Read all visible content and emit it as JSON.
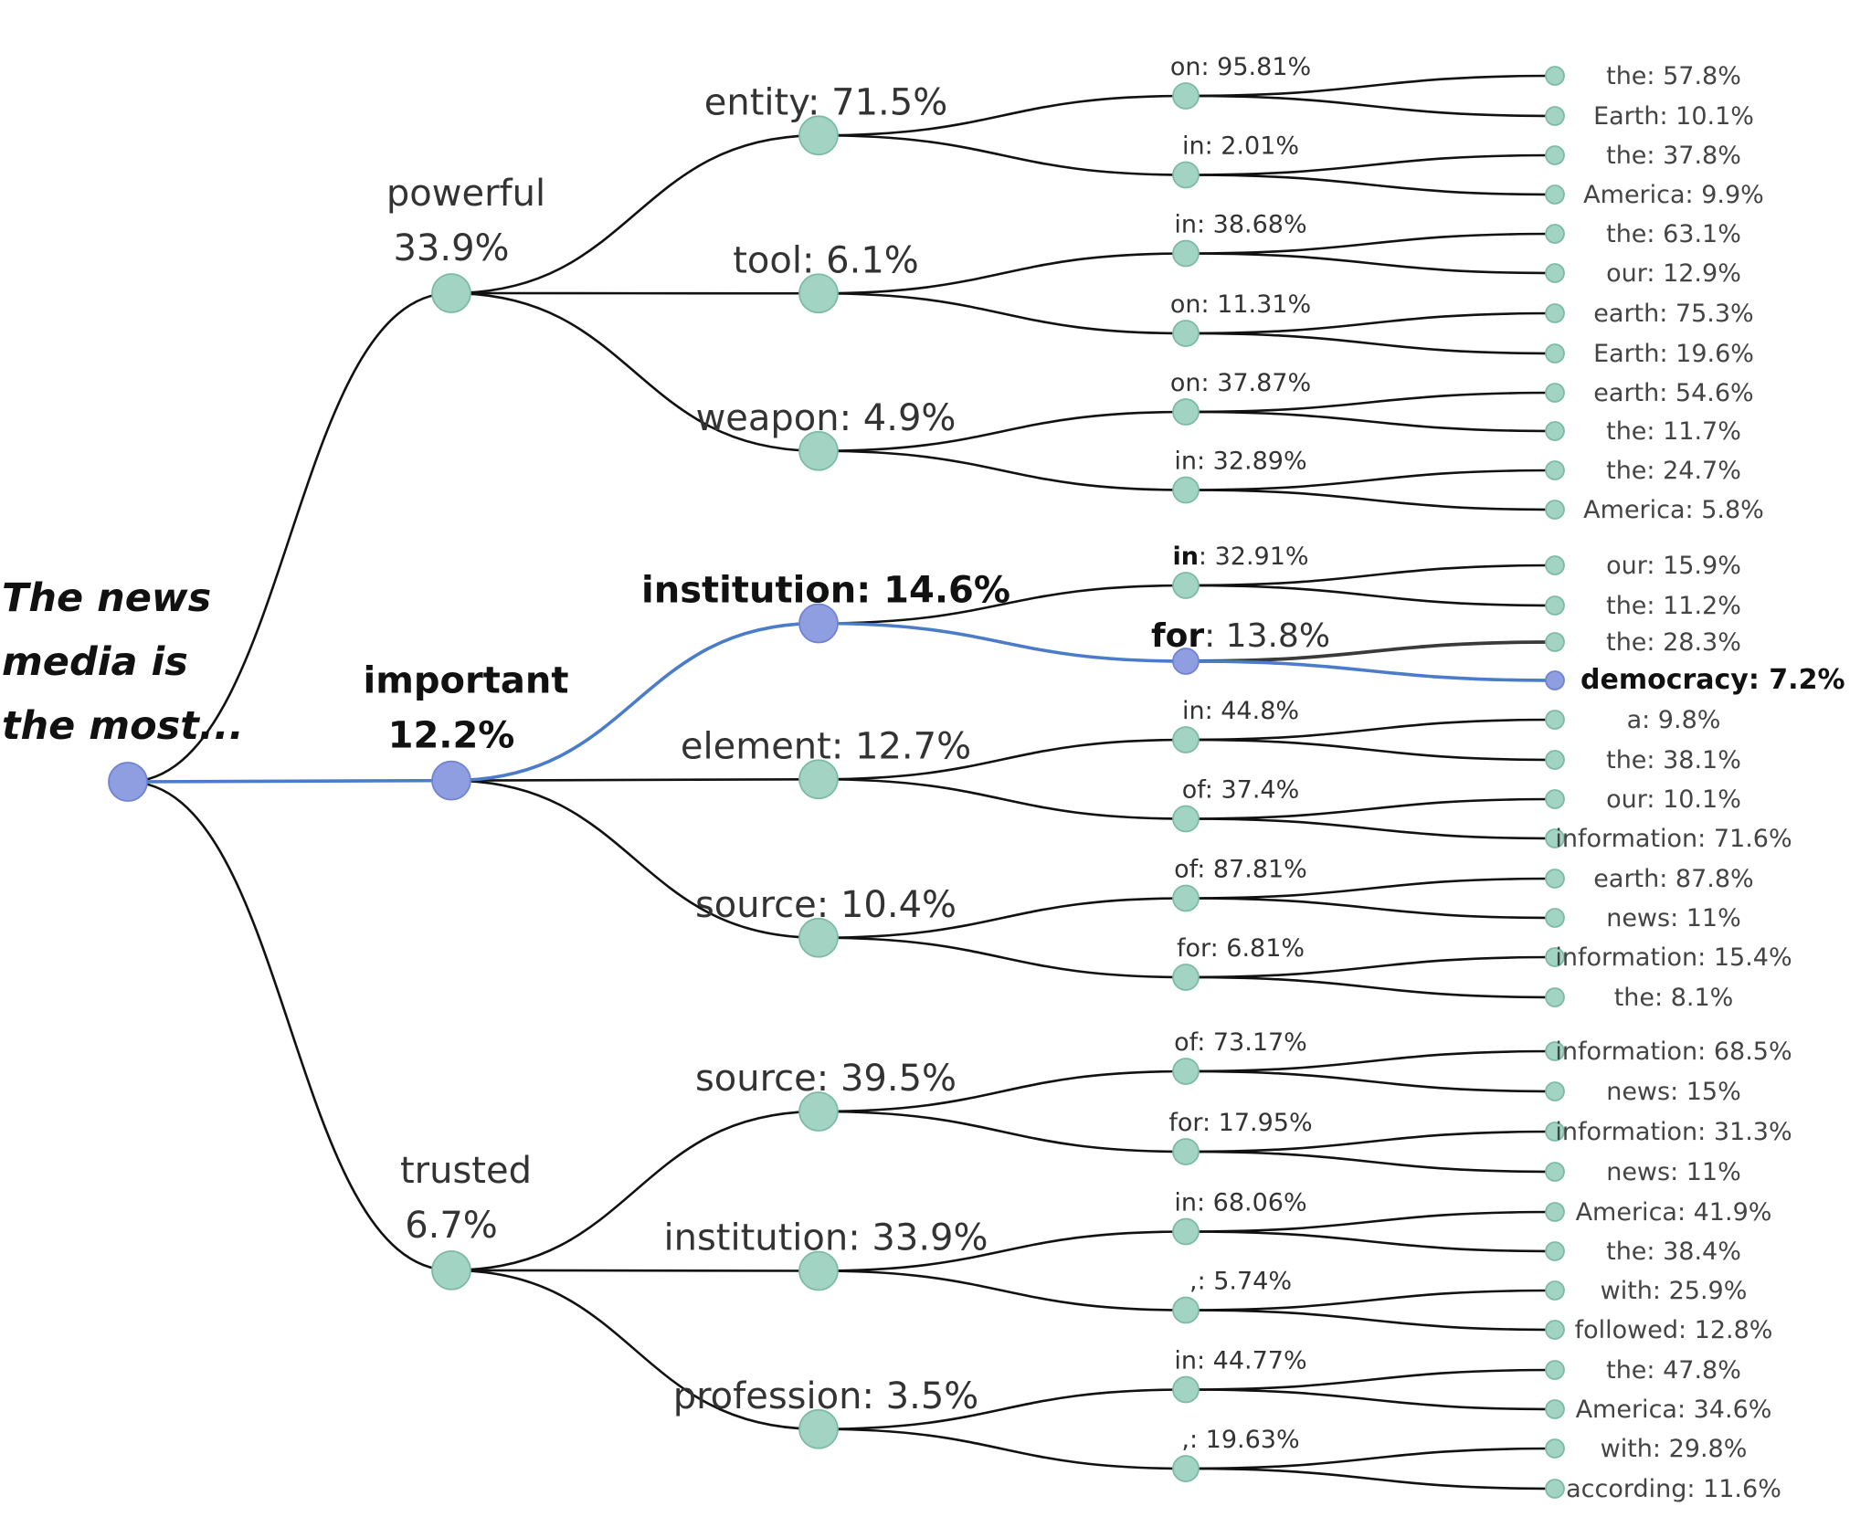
{
  "colors": {
    "node": "#a3d3c2",
    "node_highlight": "#8f9ee0",
    "edge": "#111111",
    "edge_highlight": "#4a7cc9"
  },
  "root": {
    "lines": [
      "The news",
      "media is",
      "the most..."
    ],
    "highlight": true,
    "children": [
      {
        "word": "powerful",
        "prob": "33.9%",
        "children": [
          {
            "label": "entity: 71.5%",
            "children": [
              {
                "word": "on",
                "prob": "95.81%",
                "children": [
                  {
                    "label": "the: 57.8%"
                  },
                  {
                    "label": "Earth: 10.1%"
                  }
                ]
              },
              {
                "word": "in",
                "prob": "2.01%",
                "children": [
                  {
                    "label": "the: 37.8%"
                  },
                  {
                    "label": "America: 9.9%"
                  }
                ]
              }
            ]
          },
          {
            "label": "tool: 6.1%",
            "children": [
              {
                "word": "in",
                "prob": "38.68%",
                "children": [
                  {
                    "label": "the: 63.1%"
                  },
                  {
                    "label": "our: 12.9%"
                  }
                ]
              },
              {
                "word": "on",
                "prob": "11.31%",
                "children": [
                  {
                    "label": "earth: 75.3%"
                  },
                  {
                    "label": "Earth: 19.6%"
                  }
                ]
              }
            ]
          },
          {
            "label": "weapon: 4.9%",
            "children": [
              {
                "word": "on",
                "prob": "37.87%",
                "children": [
                  {
                    "label": "earth: 54.6%"
                  },
                  {
                    "label": "the: 11.7%"
                  }
                ]
              },
              {
                "word": "in",
                "prob": "32.89%",
                "children": [
                  {
                    "label": "the: 24.7%"
                  },
                  {
                    "label": "America: 5.8%"
                  }
                ]
              }
            ]
          }
        ]
      },
      {
        "word": "important",
        "prob": "12.2%",
        "highlight": true,
        "children": [
          {
            "label": "institution: 14.6%",
            "highlight": true,
            "children": [
              {
                "word": "in",
                "prob": "32.91%",
                "bold_word": true,
                "children": [
                  {
                    "label": "our: 15.9%"
                  },
                  {
                    "label": "the: 11.2%"
                  }
                ]
              },
              {
                "word": "for",
                "prob": "13.8%",
                "highlight": true,
                "bold_word": true,
                "children": [
                  {
                    "label": "the: 28.3%",
                    "dark_edge": true
                  },
                  {
                    "label": "democracy: 7.2%",
                    "highlight": true
                  }
                ]
              }
            ]
          },
          {
            "label": "element: 12.7%",
            "children": [
              {
                "word": "in",
                "prob": "44.8%",
                "children": [
                  {
                    "label": "a: 9.8%"
                  },
                  {
                    "label": "the: 38.1%"
                  }
                ]
              },
              {
                "word": "of",
                "prob": "37.4%",
                "children": [
                  {
                    "label": "our: 10.1%"
                  },
                  {
                    "label": "information: 71.6%"
                  }
                ]
              }
            ]
          },
          {
            "label": "source: 10.4%",
            "children": [
              {
                "word": "of",
                "prob": "87.81%",
                "children": [
                  {
                    "label": "earth: 87.8%"
                  },
                  {
                    "label": "news: 11%"
                  }
                ]
              },
              {
                "word": "for",
                "prob": "6.81%",
                "children": [
                  {
                    "label": "information: 15.4%"
                  },
                  {
                    "label": "the: 8.1%"
                  }
                ]
              }
            ]
          }
        ]
      },
      {
        "word": "trusted",
        "prob": "6.7%",
        "children": [
          {
            "label": "source: 39.5%",
            "children": [
              {
                "word": "of",
                "prob": "73.17%",
                "children": [
                  {
                    "label": "information: 68.5%"
                  },
                  {
                    "label": "news: 15%"
                  }
                ]
              },
              {
                "word": "for",
                "prob": "17.95%",
                "children": [
                  {
                    "label": "information: 31.3%"
                  },
                  {
                    "label": "news: 11%"
                  }
                ]
              }
            ]
          },
          {
            "label": "institution: 33.9%",
            "children": [
              {
                "word": "in",
                "prob": "68.06%",
                "children": [
                  {
                    "label": "America: 41.9%"
                  },
                  {
                    "label": "the: 38.4%"
                  }
                ]
              },
              {
                "word": ",",
                "prob": "5.74%",
                "children": [
                  {
                    "label": "with: 25.9%"
                  },
                  {
                    "label": "followed: 12.8%"
                  }
                ]
              }
            ]
          },
          {
            "label": "profession: 3.5%",
            "children": [
              {
                "word": "in",
                "prob": "44.77%",
                "children": [
                  {
                    "label": "the: 47.8%"
                  },
                  {
                    "label": "America: 34.6%"
                  }
                ]
              },
              {
                "word": ",",
                "prob": "19.63%",
                "children": [
                  {
                    "label": "with: 29.8%"
                  },
                  {
                    "label": "according: 11.6%"
                  }
                ]
              }
            ]
          }
        ]
      }
    ]
  }
}
